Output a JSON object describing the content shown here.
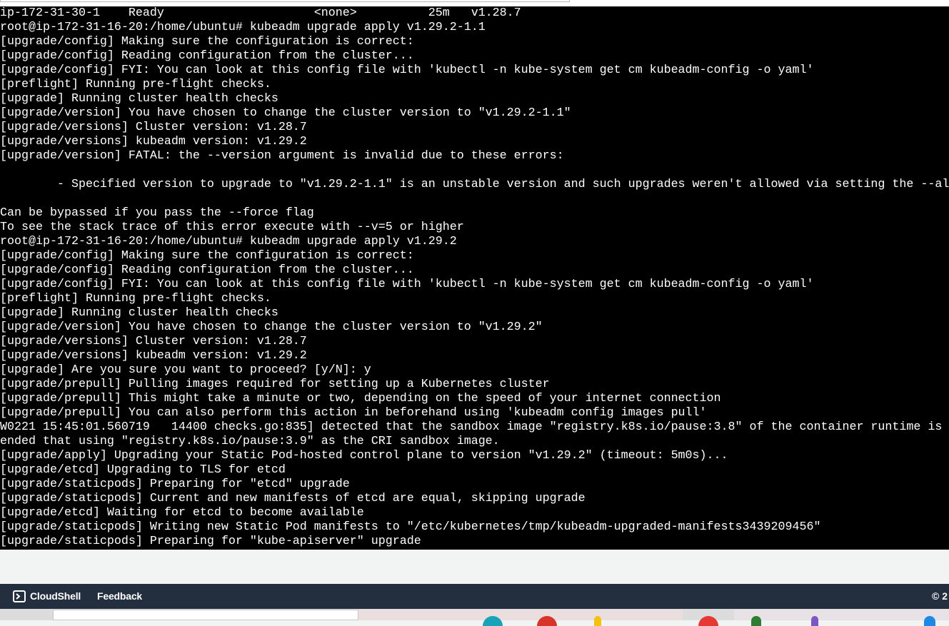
{
  "terminal": {
    "lines": [
      "ip-172-31-30-1    Ready                     <none>          25m   v1.28.7",
      "root@ip-172-31-16-20:/home/ubuntu# kubeadm upgrade apply v1.29.2-1.1",
      "[upgrade/config] Making sure the configuration is correct:",
      "[upgrade/config] Reading configuration from the cluster...",
      "[upgrade/config] FYI: You can look at this config file with 'kubectl -n kube-system get cm kubeadm-config -o yaml'",
      "[preflight] Running pre-flight checks.",
      "[upgrade] Running cluster health checks",
      "[upgrade/version] You have chosen to change the cluster version to \"v1.29.2-1.1\"",
      "[upgrade/versions] Cluster version: v1.28.7",
      "[upgrade/versions] kubeadm version: v1.29.2",
      "[upgrade/version] FATAL: the --version argument is invalid due to these errors:",
      "",
      "        - Specified version to upgrade to \"v1.29.2-1.1\" is an unstable version and such upgrades weren't allowed via setting the --al",
      "",
      "Can be bypassed if you pass the --force flag",
      "To see the stack trace of this error execute with --v=5 or higher",
      "root@ip-172-31-16-20:/home/ubuntu# kubeadm upgrade apply v1.29.2",
      "[upgrade/config] Making sure the configuration is correct:",
      "[upgrade/config] Reading configuration from the cluster...",
      "[upgrade/config] FYI: You can look at this config file with 'kubectl -n kube-system get cm kubeadm-config -o yaml'",
      "[preflight] Running pre-flight checks.",
      "[upgrade] Running cluster health checks",
      "[upgrade/version] You have chosen to change the cluster version to \"v1.29.2\"",
      "[upgrade/versions] Cluster version: v1.28.7",
      "[upgrade/versions] kubeadm version: v1.29.2",
      "[upgrade] Are you sure you want to proceed? [y/N]: y",
      "[upgrade/prepull] Pulling images required for setting up a Kubernetes cluster",
      "[upgrade/prepull] This might take a minute or two, depending on the speed of your internet connection",
      "[upgrade/prepull] You can also perform this action in beforehand using 'kubeadm config images pull'",
      "W0221 15:45:01.560719   14400 checks.go:835] detected that the sandbox image \"registry.k8s.io/pause:3.8\" of the container runtime is",
      "ended that using \"registry.k8s.io/pause:3.9\" as the CRI sandbox image.",
      "[upgrade/apply] Upgrading your Static Pod-hosted control plane to version \"v1.29.2\" (timeout: 5m0s)...",
      "[upgrade/etcd] Upgrading to TLS for etcd",
      "[upgrade/staticpods] Preparing for \"etcd\" upgrade",
      "[upgrade/staticpods] Current and new manifests of etcd are equal, skipping upgrade",
      "[upgrade/etcd] Waiting for etcd to become available",
      "[upgrade/staticpods] Writing new Static Pod manifests to \"/etc/kubernetes/tmp/kubeadm-upgraded-manifests3439209456\"",
      "[upgrade/staticpods] Preparing for \"kube-apiserver\" upgrade"
    ]
  },
  "footer": {
    "cloudshell_label": "CloudShell",
    "feedback_label": "Feedback",
    "copyright": "© 2",
    "background": "#232f3e"
  },
  "colors": {
    "terminal_bg": "#000000",
    "terminal_fg": "#ffffff"
  }
}
